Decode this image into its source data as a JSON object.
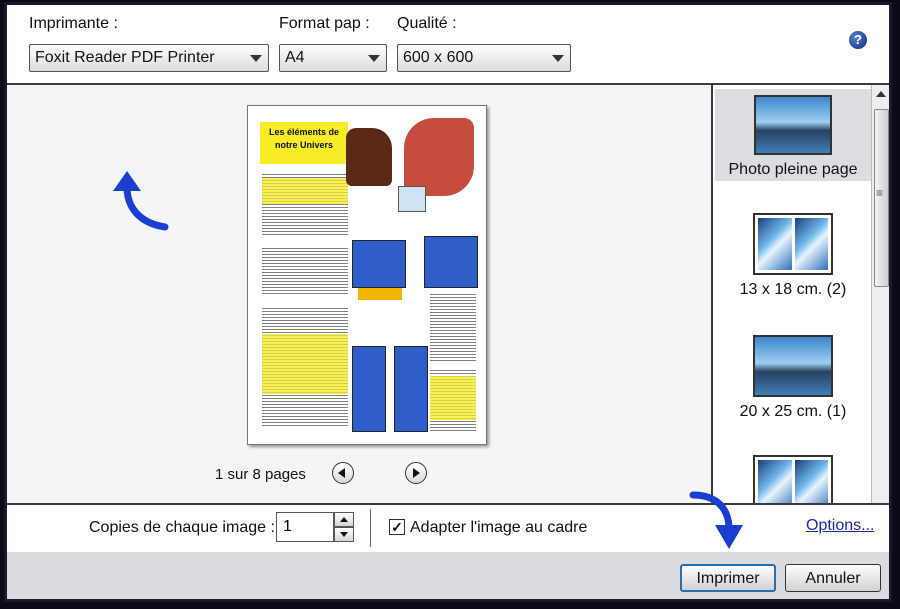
{
  "toolbar": {
    "printer_label": "Imprimante :",
    "printer_value": "Foxit Reader PDF Printer",
    "paper_label": "Format pap :",
    "paper_value": "A4",
    "quality_label": "Qualité :",
    "quality_value": "600 x 600",
    "help_glyph": "?"
  },
  "preview": {
    "page_title": "Les éléments de notre Univers",
    "page_counter": "1 sur 8 pages",
    "current_page": 1,
    "total_pages": 8
  },
  "layouts": {
    "items": [
      {
        "label": "Photo pleine page",
        "selected": true
      },
      {
        "label": "13 x 18 cm. (2)",
        "selected": false
      },
      {
        "label": "20 x 25 cm. (1)",
        "selected": false
      },
      {
        "label": "",
        "selected": false
      }
    ]
  },
  "options": {
    "copies_label": "Copies de chaque image :",
    "copies_value": "1",
    "fit_checked": true,
    "fit_check_glyph": "✓",
    "fit_label": "Adapter l'image au cadre",
    "options_link": "Options..."
  },
  "buttons": {
    "print": "Imprimer",
    "cancel": "Annuler"
  },
  "colors": {
    "annotation_arrow": "#1a3fd0",
    "highlight_yellow": "#f7ec25",
    "link_blue": "#1a2a9a"
  },
  "icons": {
    "help": "help-icon",
    "prev": "previous-page-icon",
    "next": "next-page-icon",
    "checkbox": "checkmark-icon"
  }
}
